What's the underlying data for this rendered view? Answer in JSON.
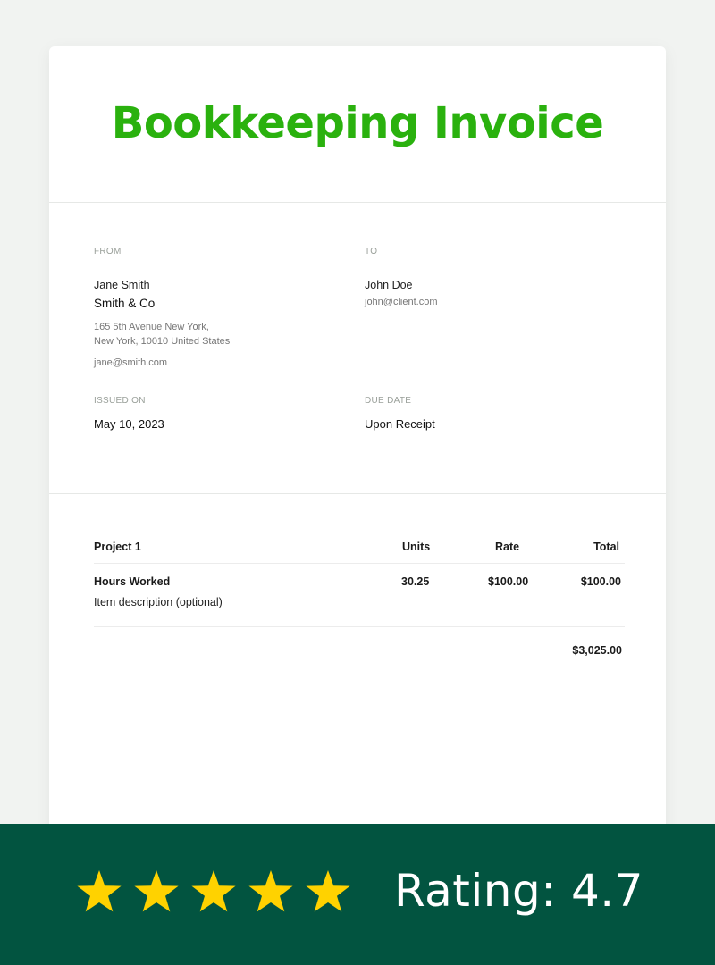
{
  "invoice": {
    "title": "Bookkeeping Invoice",
    "from": {
      "label": "FROM",
      "name": "Jane Smith",
      "company": "Smith & Co",
      "address_line1": "165 5th Avenue New York,",
      "address_line2": "New York, 10010 United States",
      "email": "jane@smith.com"
    },
    "to": {
      "label": "TO",
      "name": "John Doe",
      "email": "john@client.com"
    },
    "issued_on": {
      "label": "ISSUED ON",
      "value": "May 10, 2023"
    },
    "due_date": {
      "label": "DUE DATE",
      "value": "Upon Receipt"
    },
    "table": {
      "headers": {
        "project": "Project 1",
        "units": "Units",
        "rate": "Rate",
        "total": "Total"
      },
      "rows": [
        {
          "item": "Hours Worked",
          "description": "Item description (optional)",
          "units": "30.25",
          "rate": "$100.00",
          "total": "$100.00"
        }
      ],
      "grand_total": "$3,025.00"
    }
  },
  "banner": {
    "stars": 5,
    "rating_text": "Rating: 4.7",
    "star_color": "#ffd200",
    "background_color": "#025440"
  },
  "colors": {
    "title_green": "#2ab10e"
  }
}
